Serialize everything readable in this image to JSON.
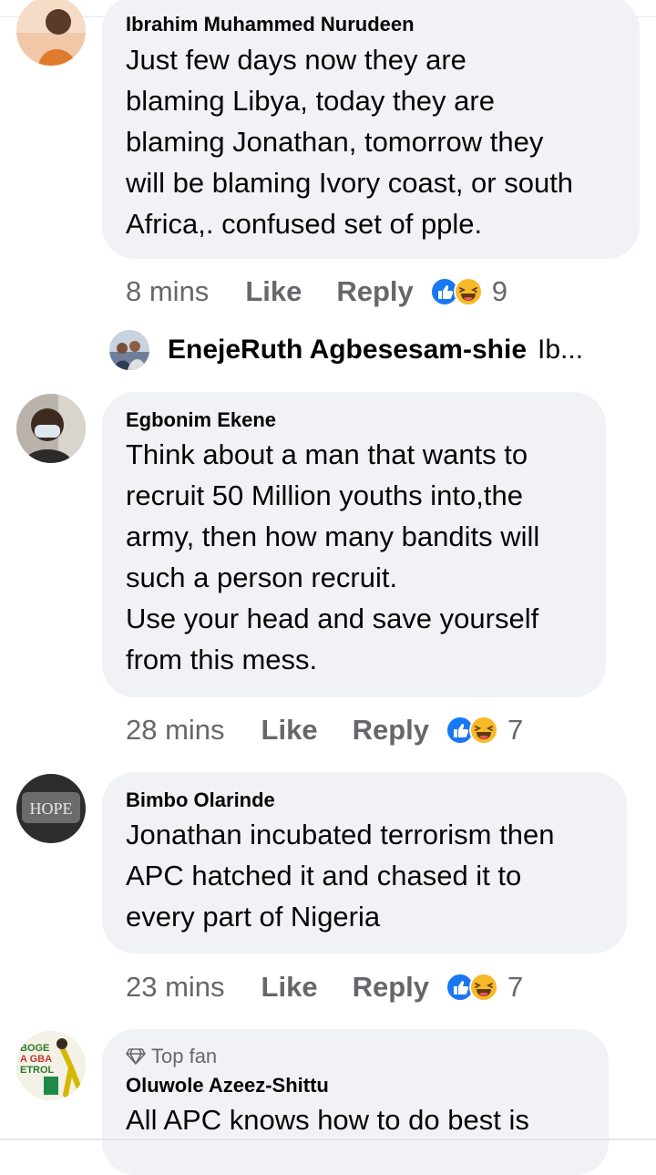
{
  "colors": {
    "bubble_bg": "#f0f2f5",
    "meta_text": "#65676b",
    "like_blue": "#1877f2",
    "haha_yellow": "#f7b928"
  },
  "comments": [
    {
      "author": "Ibrahim Muhammed Nurudeen",
      "text": "Just few days now they are\nblaming Libya, today they are\nblaming Jonathan, tomorrow they\nwill be blaming Ivory coast, or south\nAfrica,. confused set of pple.",
      "time": "8 mins",
      "like_label": "Like",
      "reply_label": "Reply",
      "reaction_count": "9",
      "reactions": [
        "like-icon",
        "haha-icon"
      ]
    },
    {
      "author": "Egbonim Ekene",
      "text": "Think about a man that wants to\nrecruit 50 Million youths into,the\narmy, then how many bandits will\nsuch a person recruit.\nUse your head and save yourself\nfrom this mess.",
      "time": "28 mins",
      "like_label": "Like",
      "reply_label": "Reply",
      "reaction_count": "7",
      "reactions": [
        "like-icon",
        "haha-icon"
      ]
    },
    {
      "author": "Bimbo Olarinde",
      "text": "Jonathan incubated terrorism then\nAPC hatched it and chased it to\nevery part of Nigeria",
      "time": "23 mins",
      "like_label": "Like",
      "reply_label": "Reply",
      "reaction_count": "7",
      "reactions": [
        "like-icon",
        "haha-icon"
      ]
    },
    {
      "badge": "Top fan",
      "author": "Oluwole Azeez-Shittu",
      "text": "All APC knows how to do best is"
    }
  ],
  "reply_preview": {
    "name": "EnejeRuth Agbesesam-shie",
    "snippet": "Ib..."
  },
  "avatar_texts": {
    "bimbo": "HOPE",
    "oluwole_line1": "BOGE",
    "oluwole_line2": "A GBA",
    "oluwole_line3": "ETROL"
  }
}
